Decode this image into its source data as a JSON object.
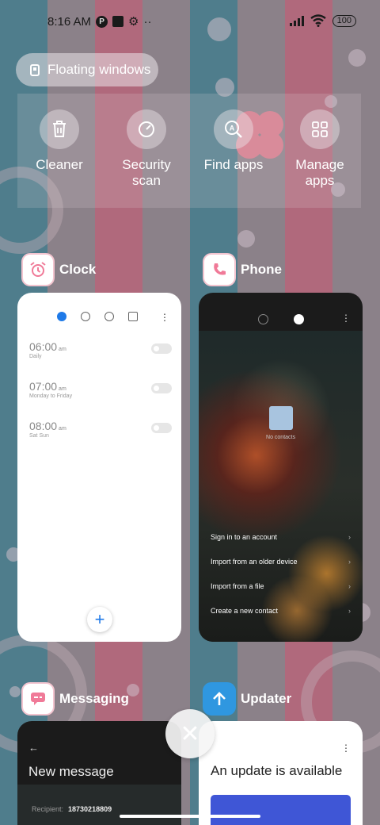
{
  "status_bar": {
    "time": "8:16 AM",
    "battery": "100"
  },
  "floating_windows": {
    "label": "Floating windows"
  },
  "quick_actions": [
    {
      "label": "Cleaner",
      "icon": "trash-icon"
    },
    {
      "label": "Security scan",
      "icon": "security-scan-icon"
    },
    {
      "label": "Find apps",
      "icon": "find-apps-icon"
    },
    {
      "label": "Manage apps",
      "icon": "grid-icon"
    }
  ],
  "apps": {
    "clock": {
      "name": "Clock",
      "alarms": [
        {
          "time": "06:00",
          "ampm": "am",
          "days": "Daily"
        },
        {
          "time": "07:00",
          "ampm": "am",
          "days": "Monday to Friday"
        },
        {
          "time": "08:00",
          "ampm": "am",
          "days": "Sat Sun"
        }
      ]
    },
    "phone": {
      "name": "Phone",
      "empty_label": "No contacts",
      "options": [
        "Sign in to an account",
        "Import from an older device",
        "Import from a file",
        "Create a new contact"
      ]
    },
    "messaging": {
      "name": "Messaging",
      "title": "New message",
      "recipient_label": "Recipient:",
      "recipient_value": "18730218809"
    },
    "updater": {
      "name": "Updater",
      "headline": "An update is available"
    }
  },
  "colors": {
    "accent_blue": "#1f7ae8",
    "stripe_pink": "#b0697c",
    "stripe_teal": "#4f7d8c",
    "stripe_grey": "#8b8189",
    "updater_icon": "#2f97e0"
  }
}
